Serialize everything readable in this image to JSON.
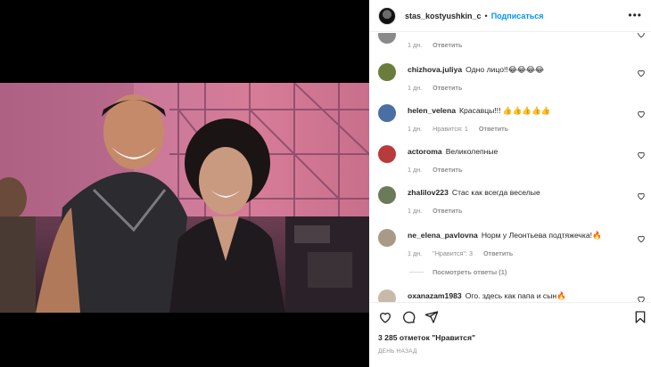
{
  "header": {
    "username": "stas_kostyushkin_c",
    "separator": "•",
    "follow_label": "Подписаться",
    "more_glyph": "•••"
  },
  "comments": [
    {
      "username": "",
      "text": "",
      "time": "1 дн.",
      "likes": "",
      "reply": "Ответить",
      "avatar_color": "#8a8a8a"
    },
    {
      "username": "chizhova.juliya",
      "text": "Одно лицо!!😂😂😂😂",
      "time": "1 дн.",
      "likes": "",
      "reply": "Ответить",
      "avatar_color": "#6b7d3a"
    },
    {
      "username": "helen_velena",
      "text": "Красавцы!!! 👍👍👍👍👍",
      "time": "1 дн.",
      "likes": "Нравится: 1",
      "reply": "Ответить",
      "avatar_color": "#4a6fa5"
    },
    {
      "username": "actoroma",
      "text": "Великолепные",
      "time": "1 дн.",
      "likes": "",
      "reply": "Ответить",
      "avatar_color": "#b83a3a"
    },
    {
      "username": "zhalilov223",
      "text": "Стас как всегда веселые",
      "time": "1 дн.",
      "likes": "",
      "reply": "Ответить",
      "avatar_color": "#6c7a5a"
    },
    {
      "username": "ne_elena_pavlovna",
      "text": "Норм у Леонтьева подтяжечка!🔥",
      "time": "1 дн.",
      "likes": "\"Нравится\": 3",
      "reply": "Ответить",
      "avatar_color": "#a99a88"
    },
    {
      "username": "oxanazam1983",
      "text": "Ого. здесь как папа и сын🔥",
      "time": "",
      "likes": "",
      "reply": "",
      "avatar_color": "#c9b9a9"
    }
  ],
  "view_replies": "Посмотреть ответы (1)",
  "likes_count": "3 285 отметок \"Нравится\"",
  "date": "ДЕНЬ НАЗАД",
  "icons": [
    "heart-icon",
    "comment-icon",
    "share-icon",
    "bookmark-icon",
    "more-icon"
  ],
  "colors": {
    "accent": "#0095f6",
    "text": "#262626",
    "muted": "#8e8e8e",
    "emoji_yellow": "#f7c948",
    "fire": "#f26a1b"
  }
}
